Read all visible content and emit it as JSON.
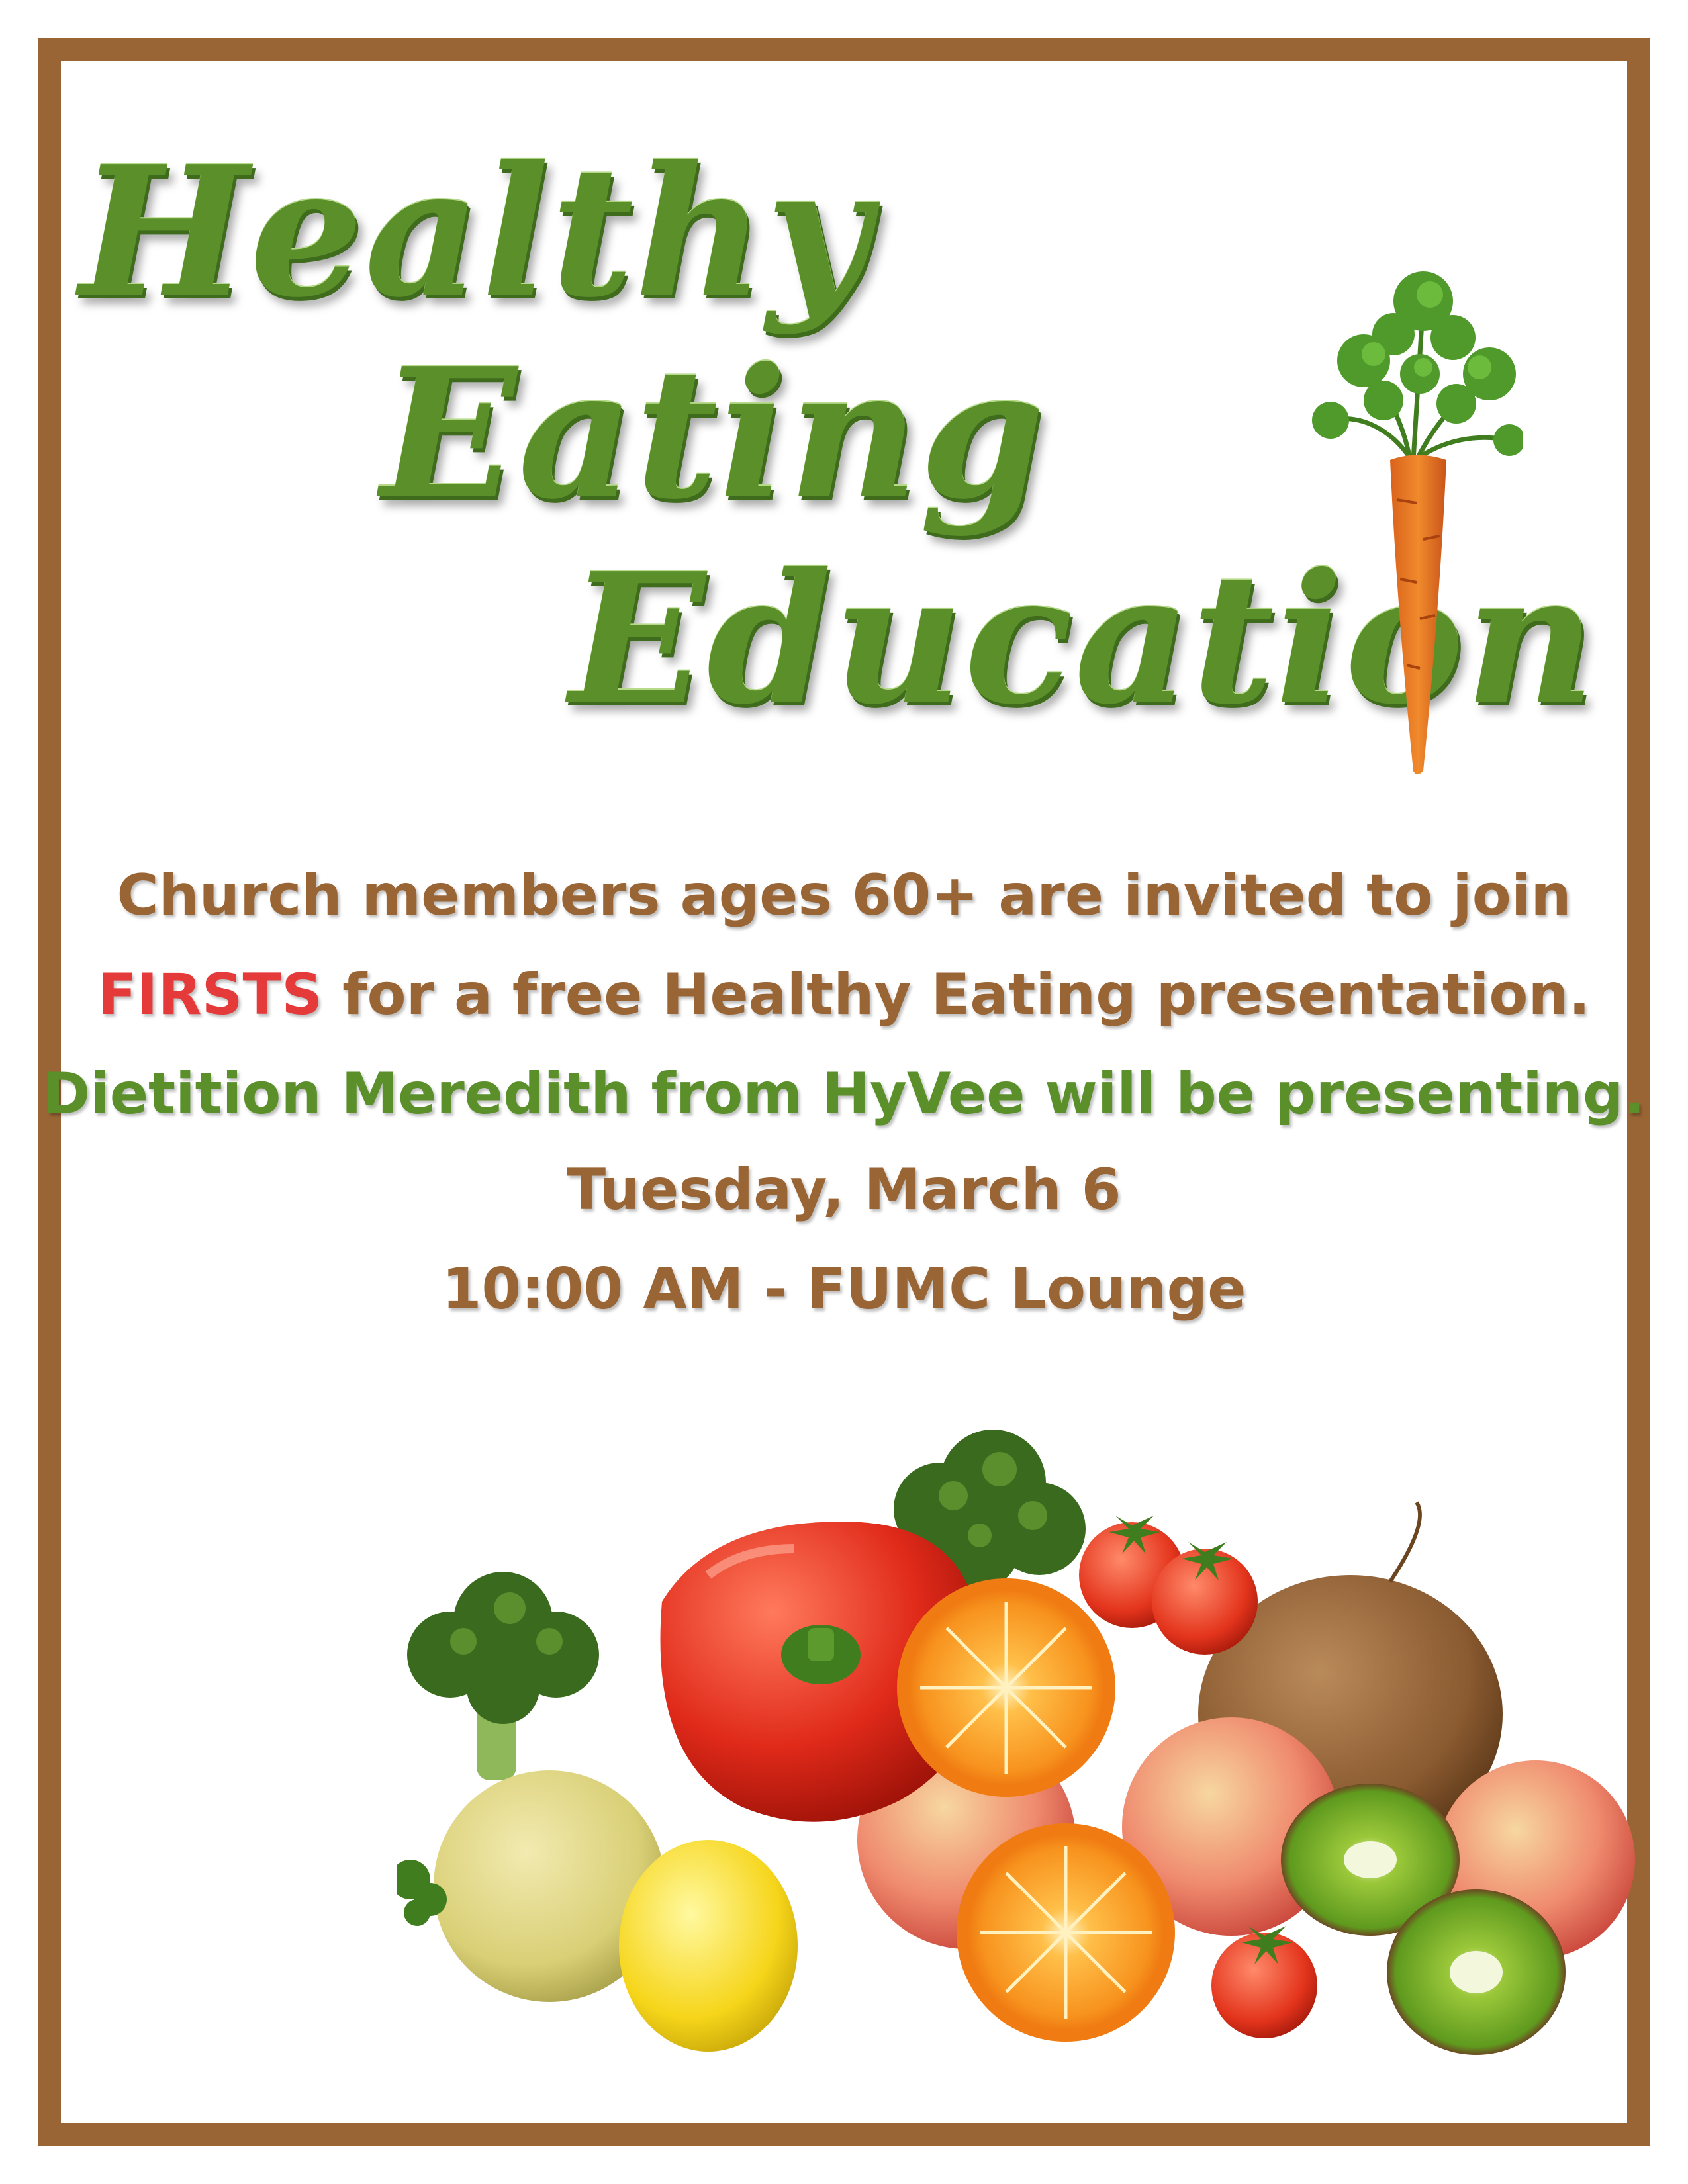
{
  "title": {
    "line1": "Healthy",
    "line2": "Eating",
    "line3": "Education"
  },
  "invite": {
    "line1": "Church members ages 60+ are invited to join",
    "firsts": "FIRSTS",
    "line2_rest": " for a free Healthy Eating presentation.",
    "line3": "Dietition Meredith from HyVee will be presenting.",
    "date": "Tuesday, March 6",
    "time_place": "10:00 AM - FUMC Lounge"
  },
  "colors": {
    "border": "#9a6535",
    "title_green": "#5a8f2a",
    "text_brown": "#9a6535",
    "accent_red": "#e53a3a"
  },
  "images": {
    "carrot": "carrot-illustration",
    "fruit": "fruit-and-vegetable-pile"
  }
}
